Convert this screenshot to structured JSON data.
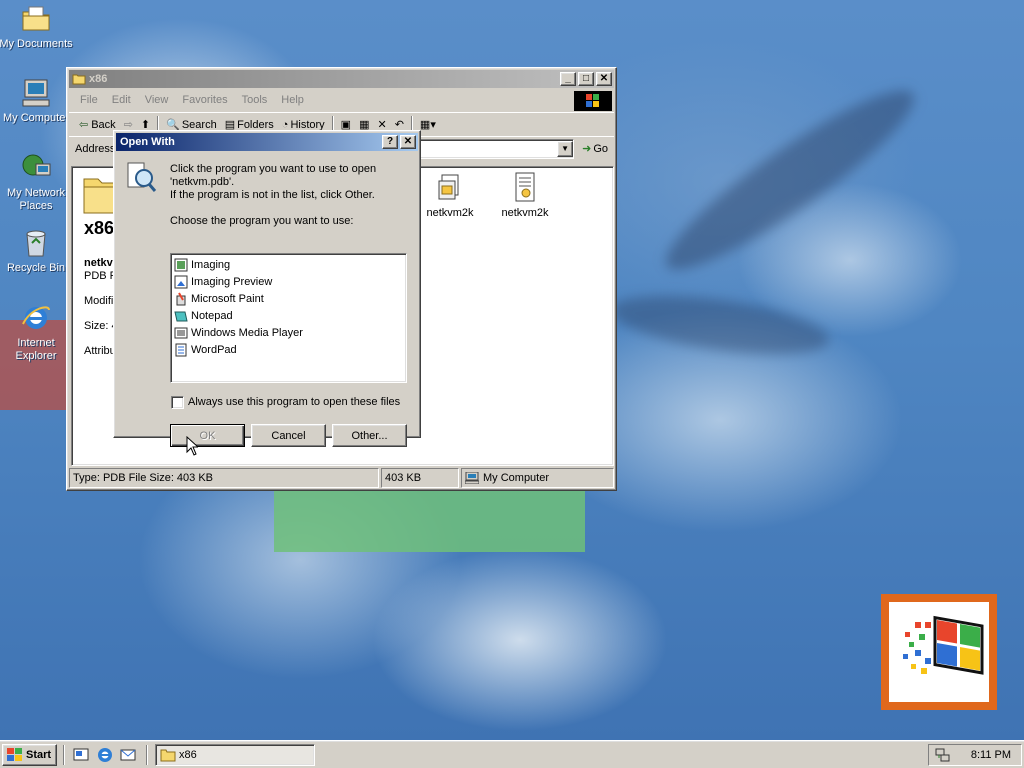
{
  "desktop": {
    "icons": [
      {
        "label": "My Documents",
        "icon": "folder-icon"
      },
      {
        "label": "My Computer",
        "icon": "computer-icon"
      },
      {
        "label": "My Network Places",
        "icon": "network-icon"
      },
      {
        "label": "Recycle Bin",
        "icon": "recycle-bin-icon"
      },
      {
        "label": "Internet Explorer",
        "icon": "ie-icon"
      }
    ]
  },
  "explorer": {
    "title": "x86",
    "menu": [
      "File",
      "Edit",
      "View",
      "Favorites",
      "Tools",
      "Help"
    ],
    "toolbar": {
      "back": "Back",
      "search": "Search",
      "folders": "Folders",
      "history": "History"
    },
    "address_label": "Address",
    "go_label": "Go",
    "info": {
      "folder_name": "x86",
      "file_name": "netkvm.pdb",
      "file_type": "PDB File",
      "modified_label": "Modified:",
      "size_label": "Size: 4",
      "attributes_label": "Attributes:"
    },
    "files": [
      {
        "name": "netkvm2k",
        "icon": "setup-file-icon"
      },
      {
        "name": "netkvm2k",
        "icon": "inf-file-icon"
      }
    ],
    "status": {
      "type_size": "Type: PDB File Size: 403 KB",
      "size": "403 KB",
      "zone": "My Computer"
    }
  },
  "dialog": {
    "title": "Open With",
    "help_button": "?",
    "close_button": "✕",
    "instruction_line1": "Click the program you want to use to open",
    "instruction_line2": "'netkvm.pdb'.",
    "instruction_line3": "If the program is not in the list, click Other.",
    "choose_label": "Choose the program you want to use:",
    "programs": [
      {
        "label": "Imaging",
        "icon": "imaging-icon"
      },
      {
        "label": "Imaging Preview",
        "icon": "imaging-preview-icon"
      },
      {
        "label": "Microsoft Paint",
        "icon": "paint-icon"
      },
      {
        "label": "Notepad",
        "icon": "notepad-icon"
      },
      {
        "label": "Windows Media Player",
        "icon": "media-player-icon"
      },
      {
        "label": "WordPad",
        "icon": "wordpad-icon"
      }
    ],
    "always_use_label": "Always use this program to open these files",
    "always_use_checked": false,
    "ok_label": "OK",
    "cancel_label": "Cancel",
    "other_label": "Other..."
  },
  "taskbar": {
    "start_label": "Start",
    "task_label": "x86",
    "clock": "8:11 PM"
  }
}
